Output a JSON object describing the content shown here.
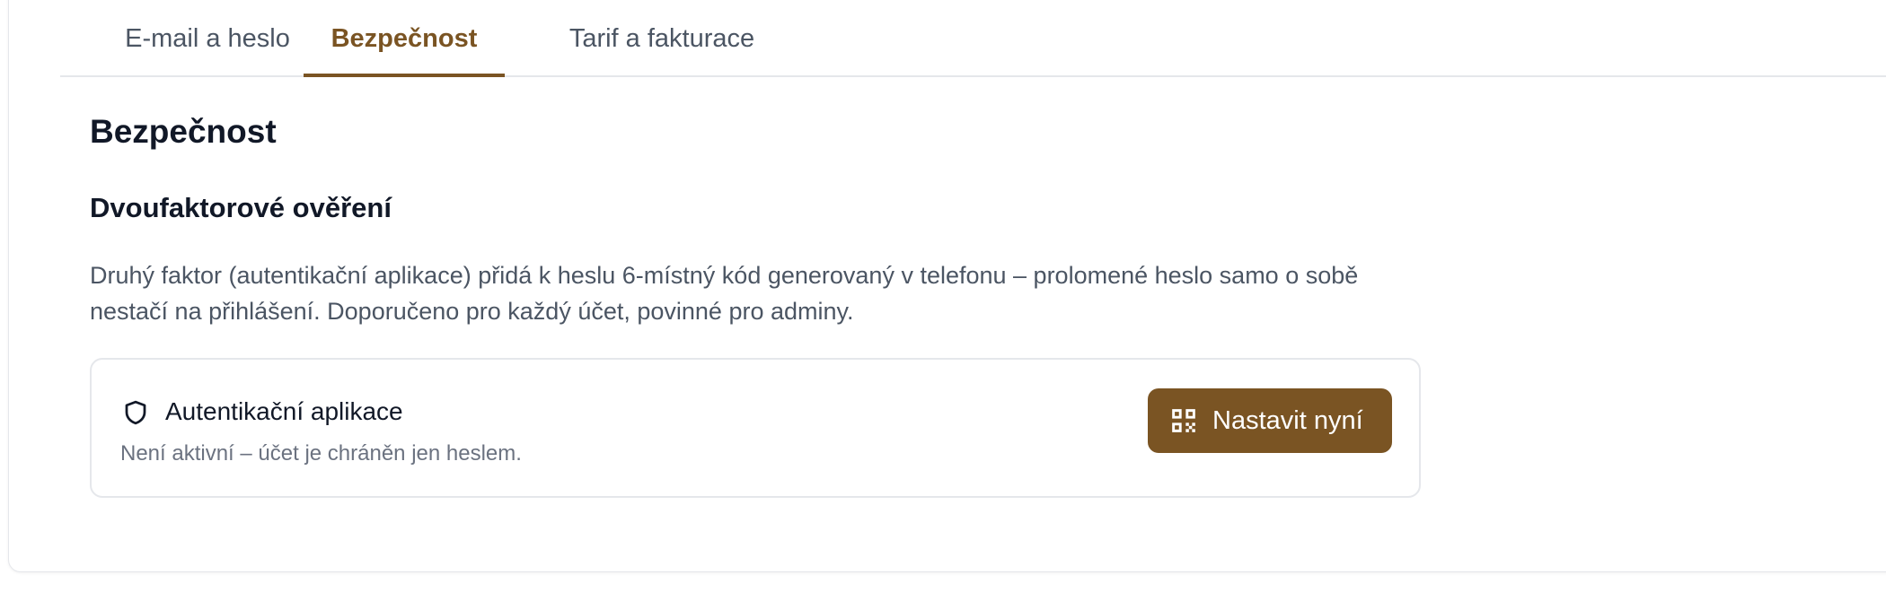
{
  "tabs": [
    {
      "label": "E-mail a heslo",
      "active": false
    },
    {
      "label": "Bezpečnost",
      "active": true
    },
    {
      "label": "Tarif a fakturace",
      "active": false
    }
  ],
  "page": {
    "title": "Bezpečnost"
  },
  "two_factor": {
    "title": "Dvoufaktorové ověření",
    "description": "Druhý faktor (autentikační aplikace) přidá k heslu 6-místný kód generovaný v telefonu – prolomené heslo samo o sobě nestačí na přihlášení. Doporučeno pro každý účet, povinné pro adminy.",
    "authenticator": {
      "icon": "shield-icon",
      "title": "Autentikační aplikace",
      "status": "Není aktivní – účet je chráněn jen heslem.",
      "button": {
        "icon": "qr-code-icon",
        "label": "Nastavit nyní"
      }
    }
  },
  "colors": {
    "accent": "#7a5423",
    "text_primary": "#111827",
    "text_secondary": "#4b5563",
    "border": "#e5e7eb"
  }
}
